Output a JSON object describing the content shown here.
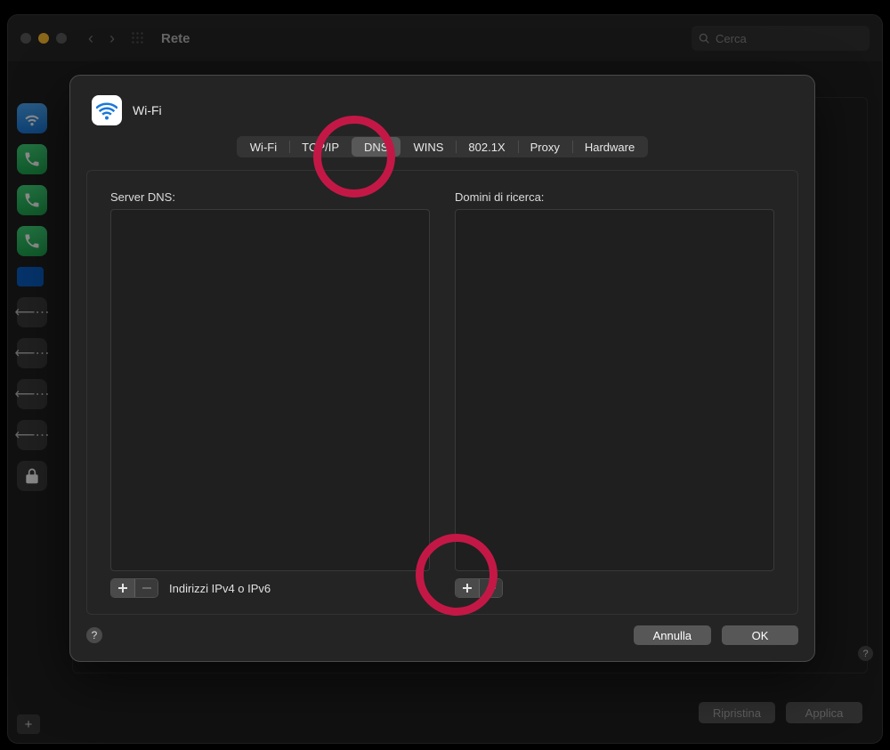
{
  "window": {
    "title": "Rete",
    "search_placeholder": "Cerca",
    "footer": {
      "revert": "Ripristina",
      "apply": "Applica"
    }
  },
  "modal": {
    "title": "Wi-Fi",
    "tabs": [
      "Wi-Fi",
      "TCP/IP",
      "DNS",
      "WINS",
      "802.1X",
      "Proxy",
      "Hardware"
    ],
    "active_tab_index": 2,
    "left": {
      "label": "Server DNS:",
      "hint": "Indirizzi IPv4 o IPv6"
    },
    "right": {
      "label": "Domini di ricerca:"
    },
    "buttons": {
      "cancel": "Annulla",
      "ok": "OK"
    }
  }
}
